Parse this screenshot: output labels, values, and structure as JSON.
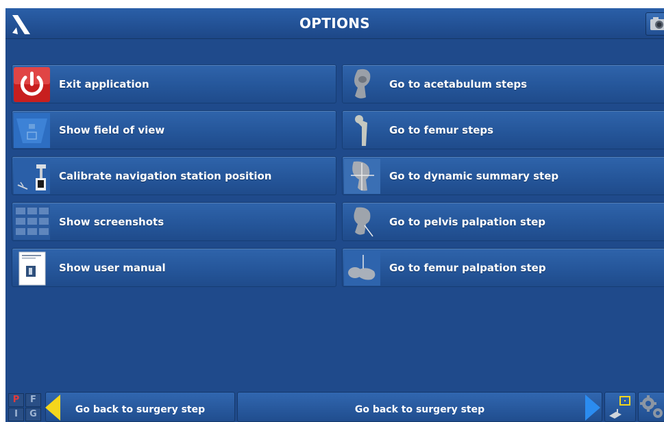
{
  "header": {
    "title": "OPTIONS"
  },
  "options_left": [
    {
      "label": "Exit application",
      "icon": "power-icon"
    },
    {
      "label": "Show field of view",
      "icon": "field-of-view-icon"
    },
    {
      "label": "Calibrate navigation station position",
      "icon": "navigation-station-icon"
    },
    {
      "label": "Show screenshots",
      "icon": "screenshots-icon"
    },
    {
      "label": "Show user manual",
      "icon": "user-manual-icon"
    }
  ],
  "options_right": [
    {
      "label": "Go to acetabulum steps",
      "icon": "acetabulum-icon"
    },
    {
      "label": "Go to femur steps",
      "icon": "femur-icon"
    },
    {
      "label": "Go to dynamic summary step",
      "icon": "dynamic-summary-icon"
    },
    {
      "label": "Go to pelvis palpation step",
      "icon": "pelvis-palpation-icon"
    },
    {
      "label": "Go to femur palpation step",
      "icon": "femur-palpation-icon"
    }
  ],
  "bottom": {
    "flags": [
      "P",
      "F",
      "I",
      "G"
    ],
    "back_left_label": "Go back to surgery step",
    "back_center_label": "Go back to surgery step"
  },
  "colors": {
    "background": "#1f4a8b",
    "button": "#25569a",
    "exit_red": "#d32a2a",
    "arrow_yellow": "#f4d61c",
    "arrow_blue": "#2b8cf0"
  }
}
